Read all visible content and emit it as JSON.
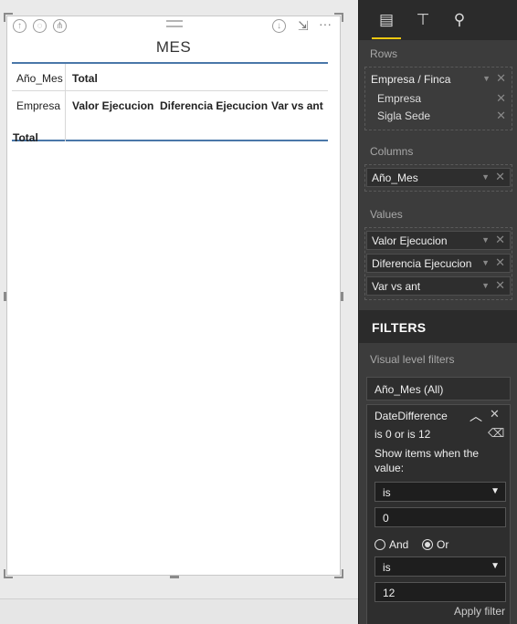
{
  "visual": {
    "title": "MES",
    "toolbar": {
      "more": "···",
      "drill_up": "↑",
      "drill_down": "↓",
      "expand": "⇲"
    },
    "matrix": {
      "header_row": [
        "Año_Mes",
        "Total"
      ],
      "sub_header": [
        "Empresa",
        "Valor Ejecucion",
        "Diferencia Ejecucion",
        "Var vs ant"
      ],
      "total_label": "Total"
    }
  },
  "pane": {
    "tabs": [
      "fields-tab",
      "format-tab",
      "analytics-tab"
    ],
    "rows": {
      "label": "Rows",
      "group": "Empresa / Finca",
      "items": [
        "Empresa",
        "Sigla Sede"
      ]
    },
    "columns": {
      "label": "Columns",
      "item": "Año_Mes"
    },
    "values": {
      "label": "Values",
      "items": [
        "Valor Ejecucion",
        "Diferencia Ejecucion",
        "Var vs ant"
      ]
    },
    "filters": {
      "title": "FILTERS",
      "section": "Visual level filters",
      "filter1": "Año_Mes  (All)",
      "filter2": {
        "name": "DateDifference",
        "summary": "is 0 or is 12",
        "show_items": "Show items when the value:",
        "cond1_op": "is",
        "cond1_val": "0",
        "and_label": "And",
        "or_label": "Or",
        "selected_logic": "Or",
        "cond2_op": "is",
        "cond2_val": "12",
        "apply": "Apply filter"
      }
    }
  },
  "colors": {
    "accent": "#f2c811",
    "matrix_line": "#4a77a9",
    "pane_bg": "#3c3c3c"
  }
}
